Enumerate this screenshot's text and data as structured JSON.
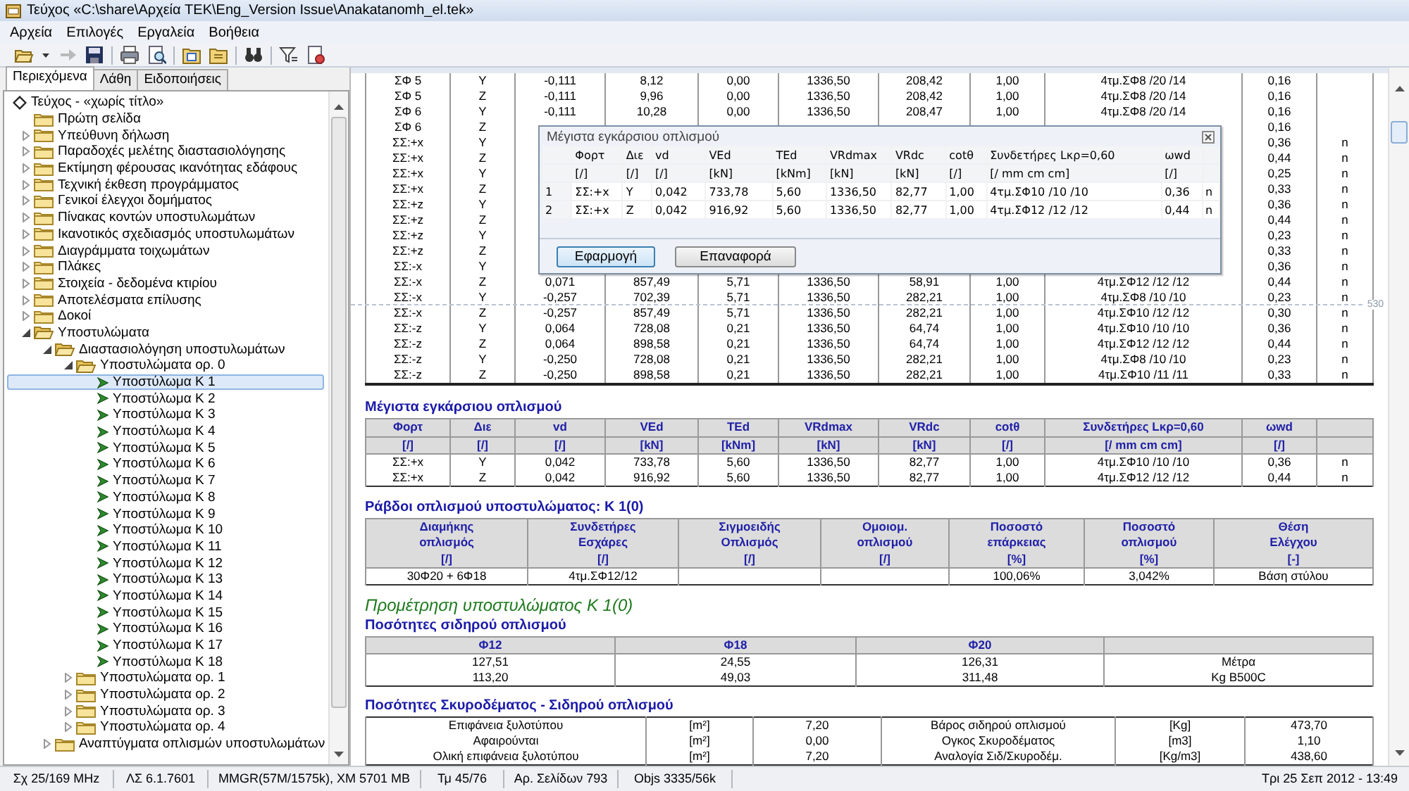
{
  "window": {
    "title": "Τεύχος «C:\\share\\Αρχεία TEK\\Eng_Version Issue\\Anakatanomh_el.tek»"
  },
  "menu": [
    "Αρχεία",
    "Επιλογές",
    "Εργαλεία",
    "Βοήθεια"
  ],
  "sidebar": {
    "tabs": [
      {
        "label": "Περιεχόμενα",
        "selected": true
      },
      {
        "label": "Λάθη",
        "selected": false
      },
      {
        "label": "Ειδοποιήσεις",
        "selected": false
      }
    ],
    "tree": [
      {
        "label": "Τεύχος - «χωρίς τίτλο»",
        "kind": "document",
        "selected": false,
        "children": [
          {
            "label": "Πρώτη σελίδα",
            "kind": "folder",
            "selected": false
          },
          {
            "label": "Υπεύθυνη δήλωση",
            "kind": "folder",
            "selected": false,
            "expanded": false
          },
          {
            "label": "Παραδοχές μελέτης διαστασιολόγησης",
            "kind": "folder",
            "selected": false,
            "expanded": false
          },
          {
            "label": "Εκτίμηση φέρουσας ικανότητας εδάφους",
            "kind": "folder",
            "selected": false,
            "expanded": false
          },
          {
            "label": "Τεχνική έκθεση προγράμματος",
            "kind": "folder",
            "selected": false,
            "expanded": false
          },
          {
            "label": "Γενικοί έλεγχοι δομήματος",
            "kind": "folder",
            "selected": false,
            "expanded": false
          },
          {
            "label": "Πίνακας κοντών υποστυλωμάτων",
            "kind": "folder",
            "selected": false,
            "expanded": false
          },
          {
            "label": "Ικανοτικός σχεδιασμός υποστυλωμάτων",
            "kind": "folder",
            "selected": false,
            "expanded": false
          },
          {
            "label": "Διαγράμματα τοιχωμάτων",
            "kind": "folder",
            "selected": false,
            "expanded": false
          },
          {
            "label": "Πλάκες",
            "kind": "folder",
            "selected": false,
            "expanded": false
          },
          {
            "label": "Στοιχεία - δεδομένα κτιρίου",
            "kind": "folder",
            "selected": false,
            "expanded": false
          },
          {
            "label": "Αποτελέσματα επίλυσης",
            "kind": "folder",
            "selected": false,
            "expanded": false
          },
          {
            "label": "Δοκοί",
            "kind": "folder",
            "selected": false,
            "expanded": false
          },
          {
            "label": "Υποστυλώματα",
            "kind": "folder",
            "selected": false,
            "expanded": true,
            "children": [
              {
                "label": "Διαστασιολόγηση υποστυλωμάτων",
                "kind": "folder",
                "selected": false,
                "expanded": true,
                "children": [
                  {
                    "label": "Υποστυλώματα ορ. 0",
                    "kind": "folder",
                    "selected": false,
                    "expanded": true,
                    "children": [
                      {
                        "label": "Υποστύλωμα Κ 1",
                        "kind": "column",
                        "selected": true
                      },
                      {
                        "label": "Υποστύλωμα Κ 2",
                        "kind": "column",
                        "selected": false
                      },
                      {
                        "label": "Υποστύλωμα Κ 3",
                        "kind": "column",
                        "selected": false
                      },
                      {
                        "label": "Υποστύλωμα Κ 4",
                        "kind": "column",
                        "selected": false
                      },
                      {
                        "label": "Υποστύλωμα Κ 5",
                        "kind": "column",
                        "selected": false
                      },
                      {
                        "label": "Υποστύλωμα Κ 6",
                        "kind": "column",
                        "selected": false
                      },
                      {
                        "label": "Υποστύλωμα Κ 7",
                        "kind": "column",
                        "selected": false
                      },
                      {
                        "label": "Υποστύλωμα Κ 8",
                        "kind": "column",
                        "selected": false
                      },
                      {
                        "label": "Υποστύλωμα Κ 9",
                        "kind": "column",
                        "selected": false
                      },
                      {
                        "label": "Υποστύλωμα Κ 10",
                        "kind": "column",
                        "selected": false
                      },
                      {
                        "label": "Υποστύλωμα Κ 11",
                        "kind": "column",
                        "selected": false
                      },
                      {
                        "label": "Υποστύλωμα Κ 12",
                        "kind": "column",
                        "selected": false
                      },
                      {
                        "label": "Υποστύλωμα Κ 13",
                        "kind": "column",
                        "selected": false
                      },
                      {
                        "label": "Υποστύλωμα Κ 14",
                        "kind": "column",
                        "selected": false
                      },
                      {
                        "label": "Υποστύλωμα Κ 15",
                        "kind": "column",
                        "selected": false
                      },
                      {
                        "label": "Υποστύλωμα Κ 16",
                        "kind": "column",
                        "selected": false
                      },
                      {
                        "label": "Υποστύλωμα Κ 17",
                        "kind": "column",
                        "selected": false
                      },
                      {
                        "label": "Υποστύλωμα Κ 18",
                        "kind": "column",
                        "selected": false
                      }
                    ]
                  },
                  {
                    "label": "Υποστυλώματα ορ. 1",
                    "kind": "folder",
                    "selected": false,
                    "expanded": false
                  },
                  {
                    "label": "Υποστυλώματα ορ. 2",
                    "kind": "folder",
                    "selected": false,
                    "expanded": false
                  },
                  {
                    "label": "Υποστυλώματα ορ. 3",
                    "kind": "folder",
                    "selected": false,
                    "expanded": false
                  },
                  {
                    "label": "Υποστυλώματα ορ. 4",
                    "kind": "folder",
                    "selected": false,
                    "expanded": false
                  }
                ]
              },
              {
                "label": "Αναπτύγματα οπλισμών υποστυλωμάτων",
                "kind": "folder",
                "selected": false,
                "expanded": false
              }
            ]
          }
        ]
      }
    ]
  },
  "document": {
    "load_table": {
      "page_break_label": "530",
      "rows": [
        {
          "covered": false,
          "cells": [
            "ΣΦ 5",
            "Y",
            "-0,111",
            "8,12",
            "0,00",
            "1336,50",
            "208,42",
            "1,00",
            "4τμ.ΣΦ8 /20 /14",
            "0,16"
          ]
        },
        {
          "covered": false,
          "cells": [
            "ΣΦ 5",
            "Z",
            "-0,111",
            "9,96",
            "0,00",
            "1336,50",
            "208,42",
            "1,00",
            "4τμ.ΣΦ8 /20 /14",
            "0,16"
          ]
        },
        {
          "covered": false,
          "cells": [
            "ΣΦ 6",
            "Y",
            "-0,111",
            "10,28",
            "0,00",
            "1336,50",
            "208,47",
            "1,00",
            "4τμ.ΣΦ8 /20 /14",
            "0,16"
          ]
        },
        {
          "covered": true,
          "cells": [
            "ΣΦ 6",
            "Z",
            "0,16"
          ]
        },
        {
          "covered": true,
          "cells": [
            "ΣΣ:+x",
            "Y",
            "0,36",
            "n"
          ]
        },
        {
          "covered": true,
          "cells": [
            "ΣΣ:+x",
            "Z",
            "0,44",
            "n"
          ]
        },
        {
          "covered": true,
          "cells": [
            "ΣΣ:+x",
            "Y",
            "0,25",
            "n"
          ]
        },
        {
          "covered": true,
          "cells": [
            "ΣΣ:+x",
            "Z",
            "0,33",
            "n"
          ]
        },
        {
          "covered": true,
          "cells": [
            "ΣΣ:+z",
            "Y",
            "0,36",
            "n"
          ]
        },
        {
          "covered": true,
          "cells": [
            "ΣΣ:+z",
            "Z",
            "0,44",
            "n"
          ]
        },
        {
          "covered": true,
          "cells": [
            "ΣΣ:+z",
            "Y",
            "0,23",
            "n"
          ]
        },
        {
          "covered": true,
          "cells": [
            "ΣΣ:+z",
            "Z",
            "0,33",
            "n"
          ]
        },
        {
          "covered": true,
          "cells": [
            "ΣΣ:-x",
            "Y",
            "0,36",
            "n"
          ]
        },
        {
          "covered": false,
          "cells": [
            "ΣΣ:-x",
            "Z",
            "0,071",
            "857,49",
            "5,71",
            "1336,50",
            "58,91",
            "1,00",
            "4τμ.ΣΦ12 /12 /12",
            "0,44",
            "n"
          ]
        },
        {
          "covered": false,
          "cells": [
            "ΣΣ:-x",
            "Y",
            "-0,257",
            "702,39",
            "5,71",
            "1336,50",
            "282,21",
            "1,00",
            "4τμ.ΣΦ8 /10 /10",
            "0,23",
            "n"
          ]
        },
        {
          "covered": false,
          "cells": [
            "ΣΣ:-x",
            "Z",
            "-0,257",
            "857,49",
            "5,71",
            "1336,50",
            "282,21",
            "1,00",
            "4τμ.ΣΦ10 /12 /12",
            "0,30",
            "n"
          ]
        },
        {
          "covered": false,
          "cells": [
            "ΣΣ:-z",
            "Y",
            "0,064",
            "728,08",
            "0,21",
            "1336,50",
            "64,74",
            "1,00",
            "4τμ.ΣΦ10 /10 /10",
            "0,36",
            "n"
          ]
        },
        {
          "covered": false,
          "cells": [
            "ΣΣ:-z",
            "Z",
            "0,064",
            "898,58",
            "0,21",
            "1336,50",
            "64,74",
            "1,00",
            "4τμ.ΣΦ12 /12 /12",
            "0,44",
            "n"
          ]
        },
        {
          "covered": false,
          "cells": [
            "ΣΣ:-z",
            "Y",
            "-0,250",
            "728,08",
            "0,21",
            "1336,50",
            "282,21",
            "1,00",
            "4τμ.ΣΦ8 /10 /10",
            "0,23",
            "n"
          ]
        },
        {
          "covered": false,
          "cells": [
            "ΣΣ:-z",
            "Z",
            "-0,250",
            "898,58",
            "0,21",
            "1336,50",
            "282,21",
            "1,00",
            "4τμ.ΣΦ10 /11 /11",
            "0,33",
            "n"
          ]
        }
      ]
    },
    "max_shear": {
      "title": "Μέγιστα εγκάρσιου οπλισμού",
      "columns": [
        {
          "name": "Φορτ",
          "unit": "[/]"
        },
        {
          "name": "Διε",
          "unit": "[/]"
        },
        {
          "name": "vd",
          "unit": "[/]"
        },
        {
          "name": "VEd",
          "unit": "[kN]"
        },
        {
          "name": "TEd",
          "unit": "[kNm]"
        },
        {
          "name": "VRdmax",
          "unit": "[kN]"
        },
        {
          "name": "VRdc",
          "unit": "[kN]"
        },
        {
          "name": "cotθ",
          "unit": "[/]"
        },
        {
          "name": "Συνδετήρες Lκρ=0,60",
          "unit": "[/ mm cm cm]"
        },
        {
          "name": "ωwd",
          "unit": "[/]"
        }
      ],
      "rows": [
        [
          "ΣΣ:+x",
          "Y",
          "0,042",
          "733,78",
          "5,60",
          "1336,50",
          "82,77",
          "1,00",
          "4τμ.ΣΦ10 /10 /10",
          "0,36",
          "n"
        ],
        [
          "ΣΣ:+x",
          "Z",
          "0,042",
          "916,92",
          "5,60",
          "1336,50",
          "82,77",
          "1,00",
          "4τμ.ΣΦ12 /12 /12",
          "0,44",
          "n"
        ]
      ]
    },
    "bars": {
      "title": "Ράβδοι οπλισμού υποστυλώματος:  Κ 1(0)",
      "columns": [
        {
          "lines": [
            "Διαμήκης",
            "οπλισμός"
          ],
          "unit": "[/]"
        },
        {
          "lines": [
            "Συνδετήρες",
            "Εσχάρες"
          ],
          "unit": "[/]"
        },
        {
          "lines": [
            "Σιγμοειδής",
            "Οπλισμός"
          ],
          "unit": "[/]"
        },
        {
          "lines": [
            "Ομοιομ.",
            "οπλισμού"
          ],
          "unit": "[/]"
        },
        {
          "lines": [
            "Ποσοστό",
            "επάρκειας"
          ],
          "unit": "[%]"
        },
        {
          "lines": [
            "Ποσοστό",
            "οπλισμού"
          ],
          "unit": "[%]"
        },
        {
          "lines": [
            "Θέση",
            "Ελέγχου"
          ],
          "unit": "[-]"
        }
      ],
      "rows": [
        [
          "30Φ20 + 6Φ18",
          "4τμ.ΣΦ12/12",
          "",
          "",
          "100,06%",
          "3,042%",
          "Βάση στύλου"
        ]
      ]
    },
    "takeoff_title": "Προμέτρηση υποστυλώματος  Κ 1(0)",
    "steel": {
      "title": "Ποσότητες σιδηρού οπλισμού",
      "columns": [
        "Φ12",
        "Φ18",
        "Φ20"
      ],
      "rows": [
        [
          "127,51",
          "24,55",
          "126,31",
          "Μέτρα"
        ],
        [
          "113,20",
          "49,03",
          "311,48",
          "Kg B500C"
        ]
      ]
    },
    "concrete": {
      "title": "Ποσότητες Σκυροδέματος - Σιδηρού οπλισμού",
      "rows": [
        [
          "Επιφάνεια ξυλοτύπου",
          "[m²]",
          "7,20",
          "Βάρος σιδηρού οπλισμού",
          "[Kg]",
          "473,70"
        ],
        [
          "Αφαιρούνται",
          "[m²]",
          "0,00",
          "Ογκος Σκυροδέματος",
          "[m3]",
          "1,10"
        ],
        [
          "Ολική επιφάνεια ξυλοτύπου",
          "[m²]",
          "7,20",
          "Αναλογία Σιδ/Σκυροδέμ.",
          "[Kg/m3]",
          "438,60"
        ]
      ]
    }
  },
  "dialog": {
    "title": "Μέγιστα εγκάρσιου οπλισμού",
    "columns": [
      {
        "name": "Φορτ",
        "unit": "[/]"
      },
      {
        "name": "Διε",
        "unit": "[/]"
      },
      {
        "name": "vd",
        "unit": "[/]"
      },
      {
        "name": "VEd",
        "unit": "[kN]"
      },
      {
        "name": "TEd",
        "unit": "[kNm]"
      },
      {
        "name": "VRdmax",
        "unit": "[kN]"
      },
      {
        "name": "VRdc",
        "unit": "[kN]"
      },
      {
        "name": "cotθ",
        "unit": "[/]"
      },
      {
        "name": "Συνδετήρες Lκρ=0,60",
        "unit": "[/ mm cm cm]"
      },
      {
        "name": "ωwd",
        "unit": "[/]"
      }
    ],
    "rows": [
      {
        "number": "1",
        "cells": [
          "ΣΣ:+x",
          "Y",
          "0,042",
          "733,78",
          "5,60",
          "1336,50",
          "82,77",
          "1,00",
          "4τμ.ΣΦ10 /10 /10",
          "0,36",
          "n"
        ]
      },
      {
        "number": "2",
        "cells": [
          "ΣΣ:+x",
          "Z",
          "0,042",
          "916,92",
          "5,60",
          "1336,50",
          "82,77",
          "1,00",
          "4τμ.ΣΦ12 /12 /12",
          "0,44",
          "n"
        ]
      }
    ],
    "buttons": [
      {
        "label": "Εφαρμογή",
        "default": true
      },
      {
        "label": "Επαναφορά",
        "default": false
      }
    ]
  },
  "status_bar": [
    "Σχ 25/169 MHz",
    "ΛΣ 6.1.7601",
    "MMGR(57M/1575k), XM 5701 MB",
    "Τμ 45/76",
    "Αρ. Σελίδων 793",
    "Objs 3335/56k",
    "Τρι 25 Σεπ 2012 - 13:49"
  ]
}
